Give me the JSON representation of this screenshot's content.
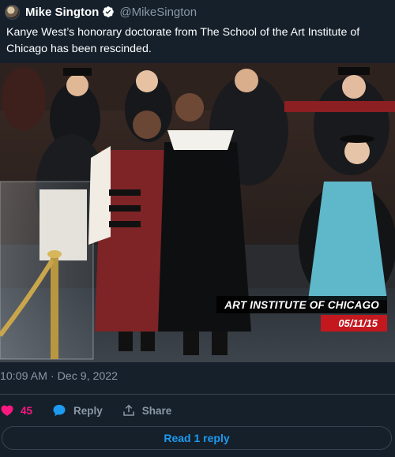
{
  "tweet": {
    "author": {
      "display_name": "Mike Sington",
      "handle": "@MikeSington",
      "verified": true,
      "avatar_icon": "avatar-photo"
    },
    "text": "Kanye West’s honorary doctorate from The School of the Art Institute of Chicago has been rescinded.",
    "media": {
      "overlay_title": "ART INSTITUTE OF CHICAGO",
      "overlay_date": "05/11/15"
    },
    "timestamp": {
      "time": "10:09 AM",
      "separator": " · ",
      "date": "Dec 9, 2022"
    },
    "actions": {
      "like_icon": "heart-icon",
      "like_count": "45",
      "reply_icon": "speech-bubble-icon",
      "reply_label": "Reply",
      "share_icon": "share-icon",
      "share_label": "Share"
    },
    "read_replies_label": "Read 1 reply"
  },
  "colors": {
    "background": "#15202b",
    "text_secondary": "#8b98a5",
    "accent_blue": "#1d9bf0",
    "like_pink": "#f91880",
    "divider": "#38444d",
    "overlay_red": "#c4181f"
  }
}
